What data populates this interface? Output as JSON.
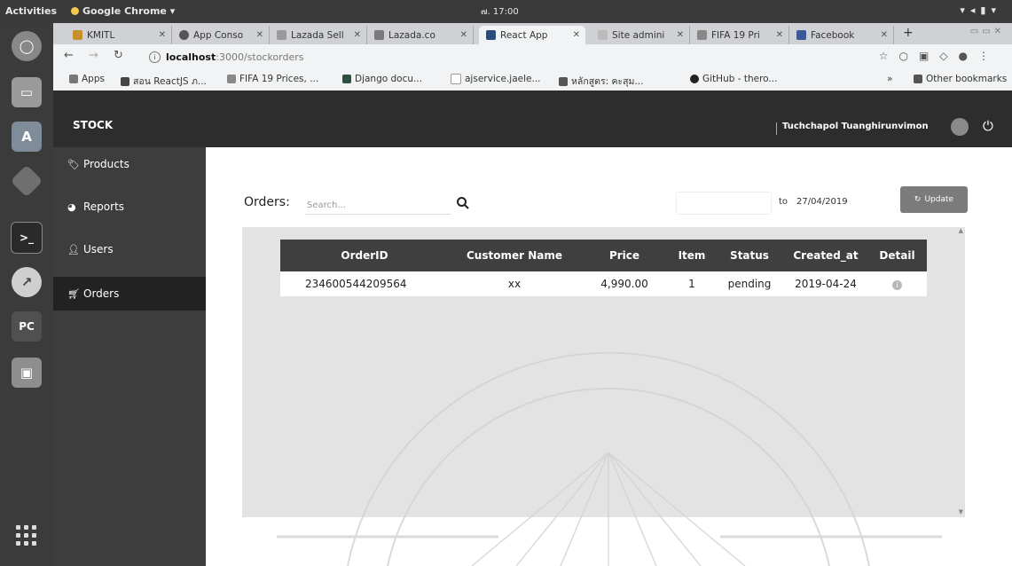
{
  "os": {
    "activities": "Activities",
    "app_menu": "Google Chrome ▾",
    "clock": "๗. 17:00"
  },
  "browser": {
    "tabs": [
      {
        "label": "KMITL",
        "color": "#c7902f"
      },
      {
        "label": "App Conso",
        "color": "#555555"
      },
      {
        "label": "Lazada Sell",
        "color": "#999999"
      },
      {
        "label": "Lazada.co",
        "color": "#7a7a7a"
      },
      {
        "label": "React App",
        "color": "#2b4d7a",
        "active": true
      },
      {
        "label": "Site admini",
        "color": "#999999"
      },
      {
        "label": "FIFA 19 Pri",
        "color": "#888888"
      },
      {
        "label": "Facebook",
        "color": "#3b5998"
      }
    ],
    "new_tab": "+",
    "url_host": "localhost",
    "url_path": ":3000/stockorders",
    "bookmarks": [
      {
        "label": "Apps",
        "color": "#777777"
      },
      {
        "label": "สอน ReactJS ภ...",
        "color": "#444444"
      },
      {
        "label": "FIFA 19 Prices, ...",
        "color": "#888888"
      },
      {
        "label": "Django docu...",
        "color": "#2f4f3f"
      },
      {
        "label": "ajservice.jaele...",
        "color": "#cccccc"
      },
      {
        "label": "หลักสูตร: คะสุม...",
        "color": "#555555"
      },
      {
        "label": "GitHub - thero...",
        "color": "#222222"
      }
    ],
    "more_bookmarks": "»",
    "other_bookmarks": "Other bookmarks"
  },
  "app": {
    "brand": "STOCK",
    "user_name": "Tuchchapol Tuanghirunvimon"
  },
  "sidebar": {
    "items": [
      {
        "label": "Products",
        "icon": "tag-icon"
      },
      {
        "label": "Reports",
        "icon": "pie-chart-icon"
      },
      {
        "label": "Users",
        "icon": "user-icon"
      },
      {
        "label": "Orders",
        "icon": "cart-icon",
        "active": true
      }
    ]
  },
  "orders": {
    "title": "Orders:",
    "search_placeholder": "Search...",
    "to_label": "to",
    "date_to": "27/04/2019",
    "update_label": "Update",
    "columns": [
      "OrderID",
      "Customer Name",
      "Price",
      "Item",
      "Status",
      "Created_at",
      "Detail"
    ],
    "rows": [
      {
        "order_id": "234600544209564",
        "customer": "xx",
        "price": "4,990.00",
        "item": "1",
        "status": "pending",
        "created_at": "2019-04-24"
      }
    ]
  },
  "colors": {
    "header_bg": "#2d2d2d",
    "sidebar_bg": "#3d3d3d",
    "table_header_bg": "#3f3f3f",
    "update_button": "#7b7b7b"
  }
}
